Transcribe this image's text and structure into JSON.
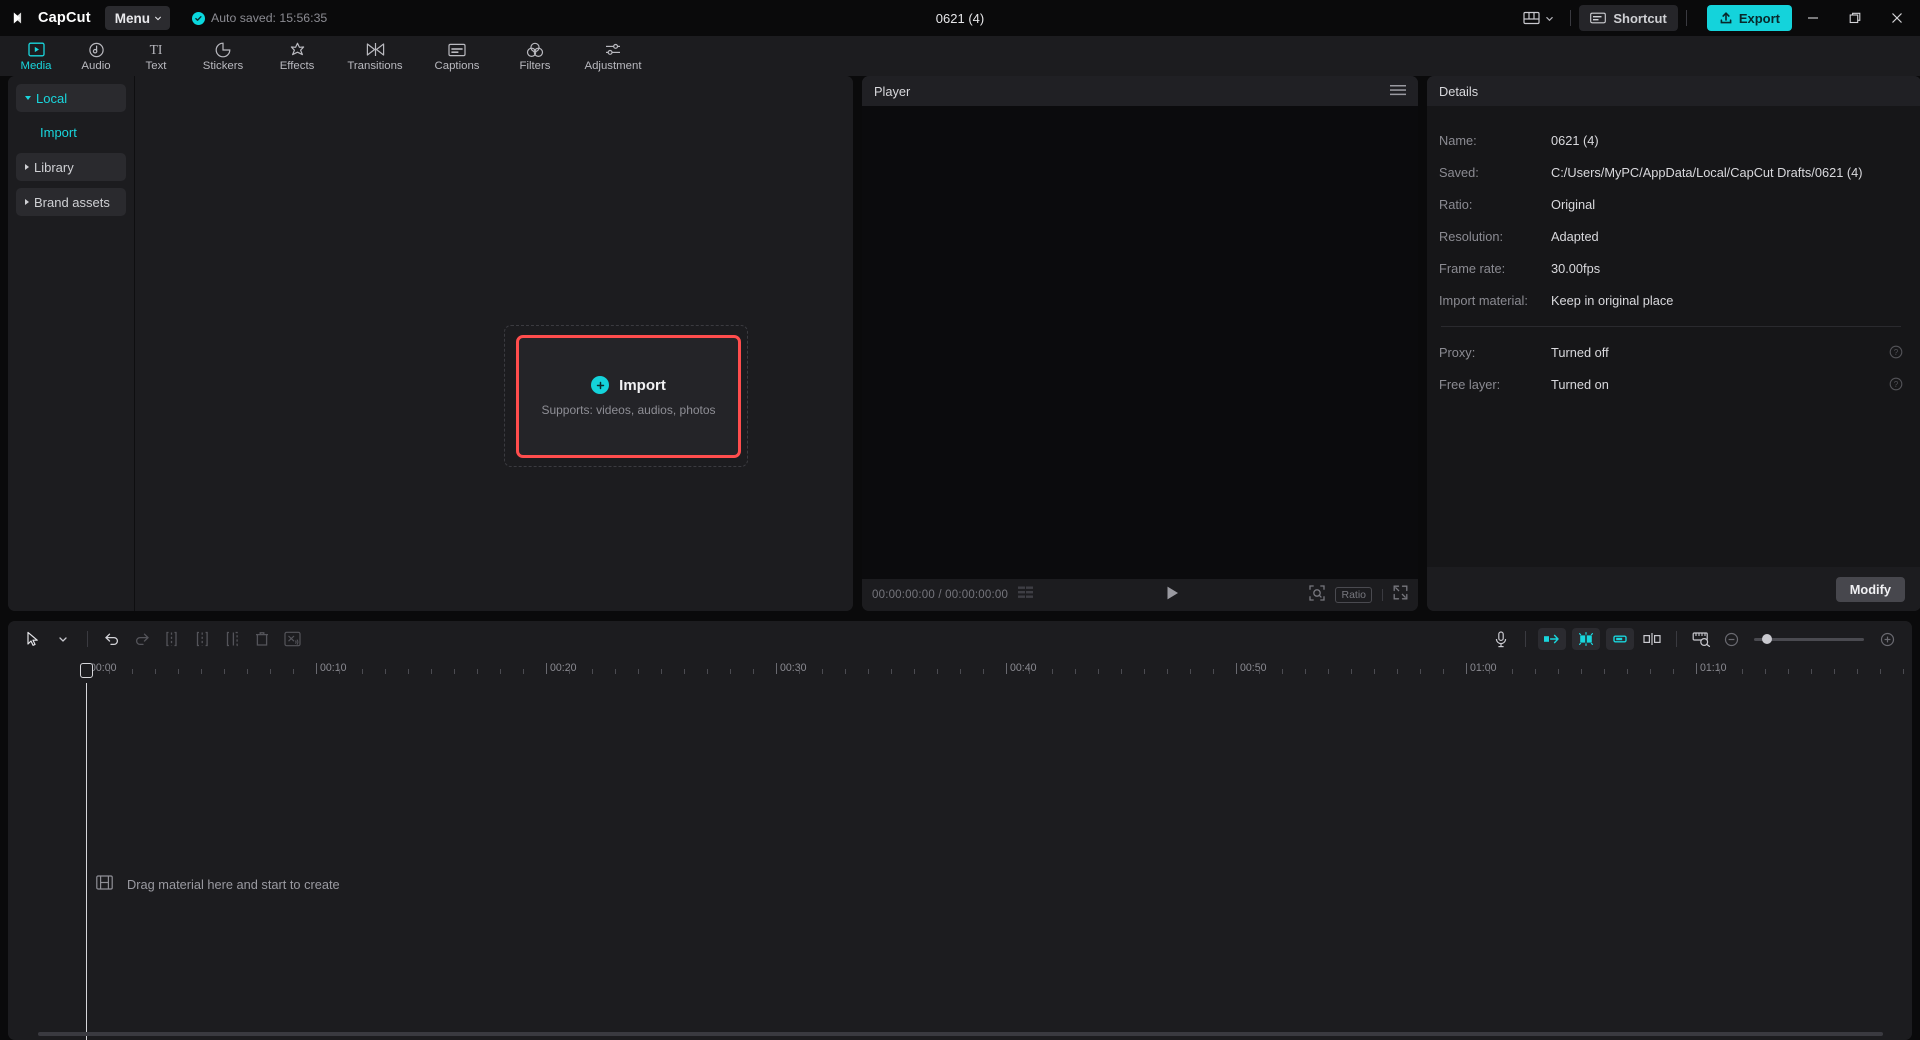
{
  "titlebar": {
    "brand": "CapCut",
    "menu_label": "Menu",
    "autosave_text": "Auto saved: 15:56:35",
    "doc_title": "0621 (4)",
    "shortcut_label": "Shortcut",
    "export_label": "Export",
    "accent": "#14d3db",
    "icons": {
      "layout": "layout-icon",
      "layout_caret": "chevron-down-icon",
      "shortcut": "keyboard-icon",
      "export": "upload-icon",
      "minimize": "minimize-icon",
      "maximize": "restore-icon",
      "close": "close-icon"
    }
  },
  "tabs": [
    {
      "label": "Media",
      "icon": "media-icon",
      "active": true
    },
    {
      "label": "Audio",
      "icon": "audio-icon",
      "active": false
    },
    {
      "label": "Text",
      "icon": "text-icon",
      "active": false
    },
    {
      "label": "Stickers",
      "icon": "stickers-icon",
      "active": false
    },
    {
      "label": "Effects",
      "icon": "effects-icon",
      "active": false
    },
    {
      "label": "Transitions",
      "icon": "transitions-icon",
      "active": false
    },
    {
      "label": "Captions",
      "icon": "captions-icon",
      "active": false
    },
    {
      "label": "Filters",
      "icon": "filters-icon",
      "active": false
    },
    {
      "label": "Adjustment",
      "icon": "adjustment-icon",
      "active": false
    }
  ],
  "media": {
    "sidebar": [
      {
        "label": "Local",
        "type": "group",
        "expanded": true
      },
      {
        "label": "Import",
        "type": "sub"
      },
      {
        "label": "Library",
        "type": "group",
        "expanded": false
      },
      {
        "label": "Brand assets",
        "type": "group",
        "expanded": false
      }
    ],
    "dropzone": {
      "import_label": "Import",
      "supports_text": "Supports: videos, audios, photos",
      "highlight_color": "#ff4d4d"
    }
  },
  "player": {
    "title": "Player",
    "current_time": "00:00:00:00",
    "total_time": "00:00:00:00",
    "time_display": "00:00:00:00 / 00:00:00:00",
    "ratio_label": "Ratio",
    "icons": {
      "menu": "hamburger-icon",
      "quality": "quality-icon",
      "play": "play-icon",
      "crop": "crop-icon",
      "fullscreen": "fullscreen-icon"
    }
  },
  "details": {
    "title": "Details",
    "rows": [
      {
        "key": "Name:",
        "value": "0621 (4)",
        "help": false
      },
      {
        "key": "Saved:",
        "value": "C:/Users/MyPC/AppData/Local/CapCut Drafts/0621 (4)",
        "help": false
      },
      {
        "key": "Ratio:",
        "value": "Original",
        "help": false
      },
      {
        "key": "Resolution:",
        "value": "Adapted",
        "help": false
      },
      {
        "key": "Frame rate:",
        "value": "30.00fps",
        "help": false
      },
      {
        "key": "Import material:",
        "value": "Keep in original place",
        "help": false
      }
    ],
    "rows2": [
      {
        "key": "Proxy:",
        "value": "Turned off",
        "help": true
      },
      {
        "key": "Free layer:",
        "value": "Turned on",
        "help": true
      }
    ],
    "modify_label": "Modify"
  },
  "timeline": {
    "drag_hint": "Drag material here and start to create",
    "ruler_labels": [
      "00:00",
      "00:10",
      "00:20",
      "00:30",
      "00:40",
      "00:50",
      "01:00",
      "01:10"
    ],
    "tools_left": [
      {
        "name": "select-tool",
        "icon": "cursor-icon",
        "dim": false
      },
      {
        "name": "select-dropdown",
        "icon": "chevron-down-icon",
        "dim": false
      },
      {
        "name": "undo-button",
        "icon": "undo-icon",
        "dim": false
      },
      {
        "name": "redo-button",
        "icon": "redo-icon",
        "dim": true
      },
      {
        "name": "split-button",
        "icon": "split-icon",
        "dim": true
      },
      {
        "name": "trim-left-button",
        "icon": "trim-left-icon",
        "dim": true
      },
      {
        "name": "trim-right-button",
        "icon": "trim-right-icon",
        "dim": true
      },
      {
        "name": "delete-button",
        "icon": "trash-icon",
        "dim": true
      },
      {
        "name": "mute-clip-button",
        "icon": "scissors-audio-icon",
        "dim": true
      }
    ],
    "tools_right": [
      {
        "name": "record-button",
        "icon": "microphone-icon",
        "active": false
      },
      {
        "name": "snap-start-button",
        "icon": "snap-left-icon",
        "active": true
      },
      {
        "name": "snap-center-button",
        "icon": "snap-center-icon",
        "active": true
      },
      {
        "name": "snap-end-button",
        "icon": "snap-right-icon",
        "active": true
      },
      {
        "name": "mirror-button",
        "icon": "mirror-icon",
        "active": false
      },
      {
        "name": "zoom-to-fit-button",
        "icon": "ruler-zoom-icon",
        "active": false
      }
    ],
    "zoom_out_icon": "zoom-out-icon",
    "zoom_in_icon": "zoom-in-icon"
  }
}
